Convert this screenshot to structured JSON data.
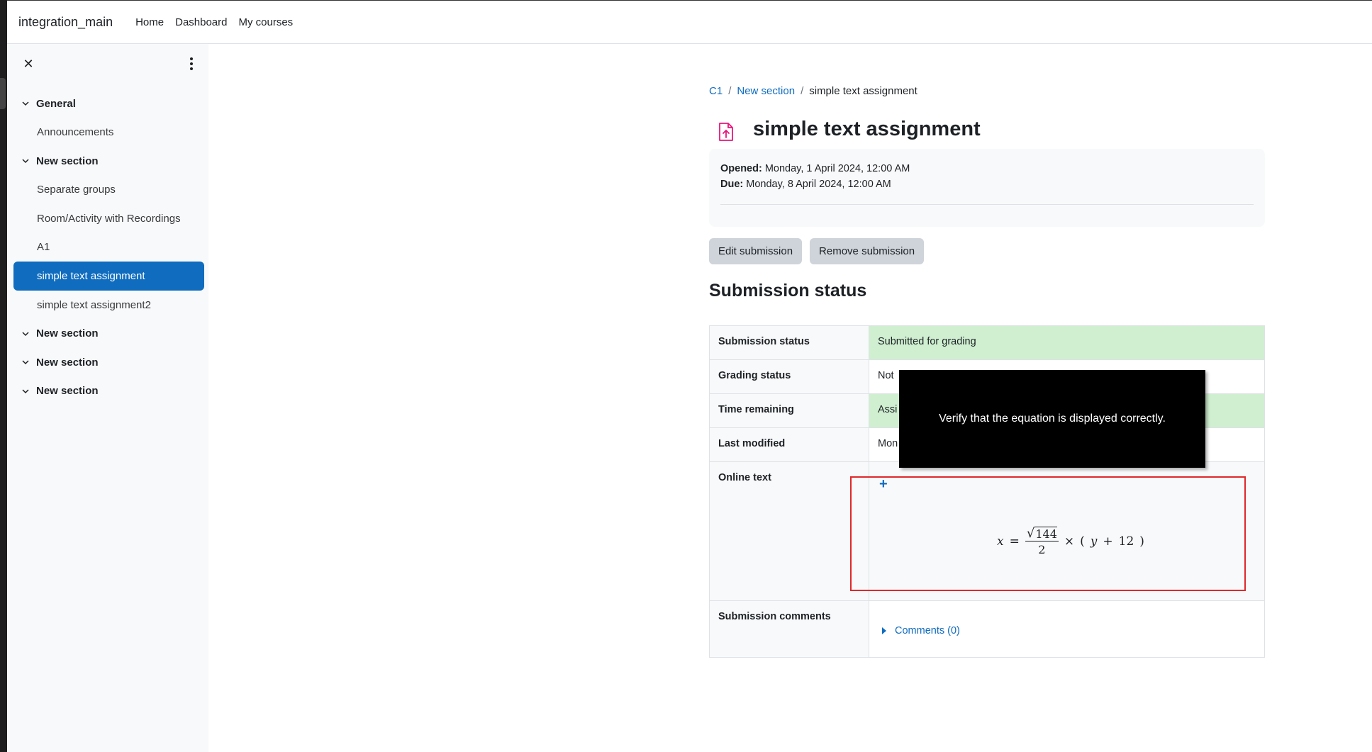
{
  "navbar": {
    "brand": "integration_main",
    "links": [
      "Home",
      "Dashboard",
      "My courses"
    ]
  },
  "sidebar": {
    "items": [
      {
        "type": "section",
        "label": "General"
      },
      {
        "type": "activity",
        "label": "Announcements"
      },
      {
        "type": "section",
        "label": "New section"
      },
      {
        "type": "activity",
        "label": "Separate groups"
      },
      {
        "type": "activity",
        "label": "Room/Activity with Recordings"
      },
      {
        "type": "activity",
        "label": "A1"
      },
      {
        "type": "activity",
        "label": "simple text assignment",
        "active": true
      },
      {
        "type": "activity",
        "label": "simple text assignment2"
      },
      {
        "type": "section",
        "label": "New section"
      },
      {
        "type": "section",
        "label": "New section"
      },
      {
        "type": "section",
        "label": "New section"
      }
    ]
  },
  "breadcrumb": {
    "items": [
      "C1",
      "New section",
      "simple text assignment"
    ],
    "separator": "/"
  },
  "page": {
    "title": "simple text assignment",
    "icon": "assignment-upload-icon",
    "icon_color": "#e8147c"
  },
  "dates": {
    "opened_label": "Opened:",
    "opened_value": "Monday, 1 April 2024, 12:00 AM",
    "due_label": "Due:",
    "due_value": "Monday, 8 April 2024, 12:00 AM"
  },
  "buttons": {
    "edit": "Edit submission",
    "remove": "Remove submission"
  },
  "submission": {
    "heading": "Submission status",
    "rows": [
      {
        "key": "Submission status",
        "value": "Submitted for grading"
      },
      {
        "key": "Grading status",
        "value": "Not"
      },
      {
        "key": "Time remaining",
        "value": "Assi"
      },
      {
        "key": "Last modified",
        "value": "Mon"
      },
      {
        "key": "Online text",
        "value": ""
      },
      {
        "key": "Submission comments",
        "value": "Comments (0)"
      }
    ],
    "equation": {
      "lhs": "x",
      "eq": "=",
      "sqrt_sym": "√",
      "numerator": "144",
      "denominator": "2",
      "times": "×",
      "rhs_open": "(",
      "rhs_var": "y",
      "rhs_plus": "+",
      "rhs_num": "12",
      "rhs_close": ")"
    }
  },
  "tooltip": {
    "text": "Verify that the equation is displayed correctly."
  },
  "colors": {
    "primary": "#0f6cbf",
    "success_bg": "#cfefd0",
    "highlight": "#e0282b"
  }
}
